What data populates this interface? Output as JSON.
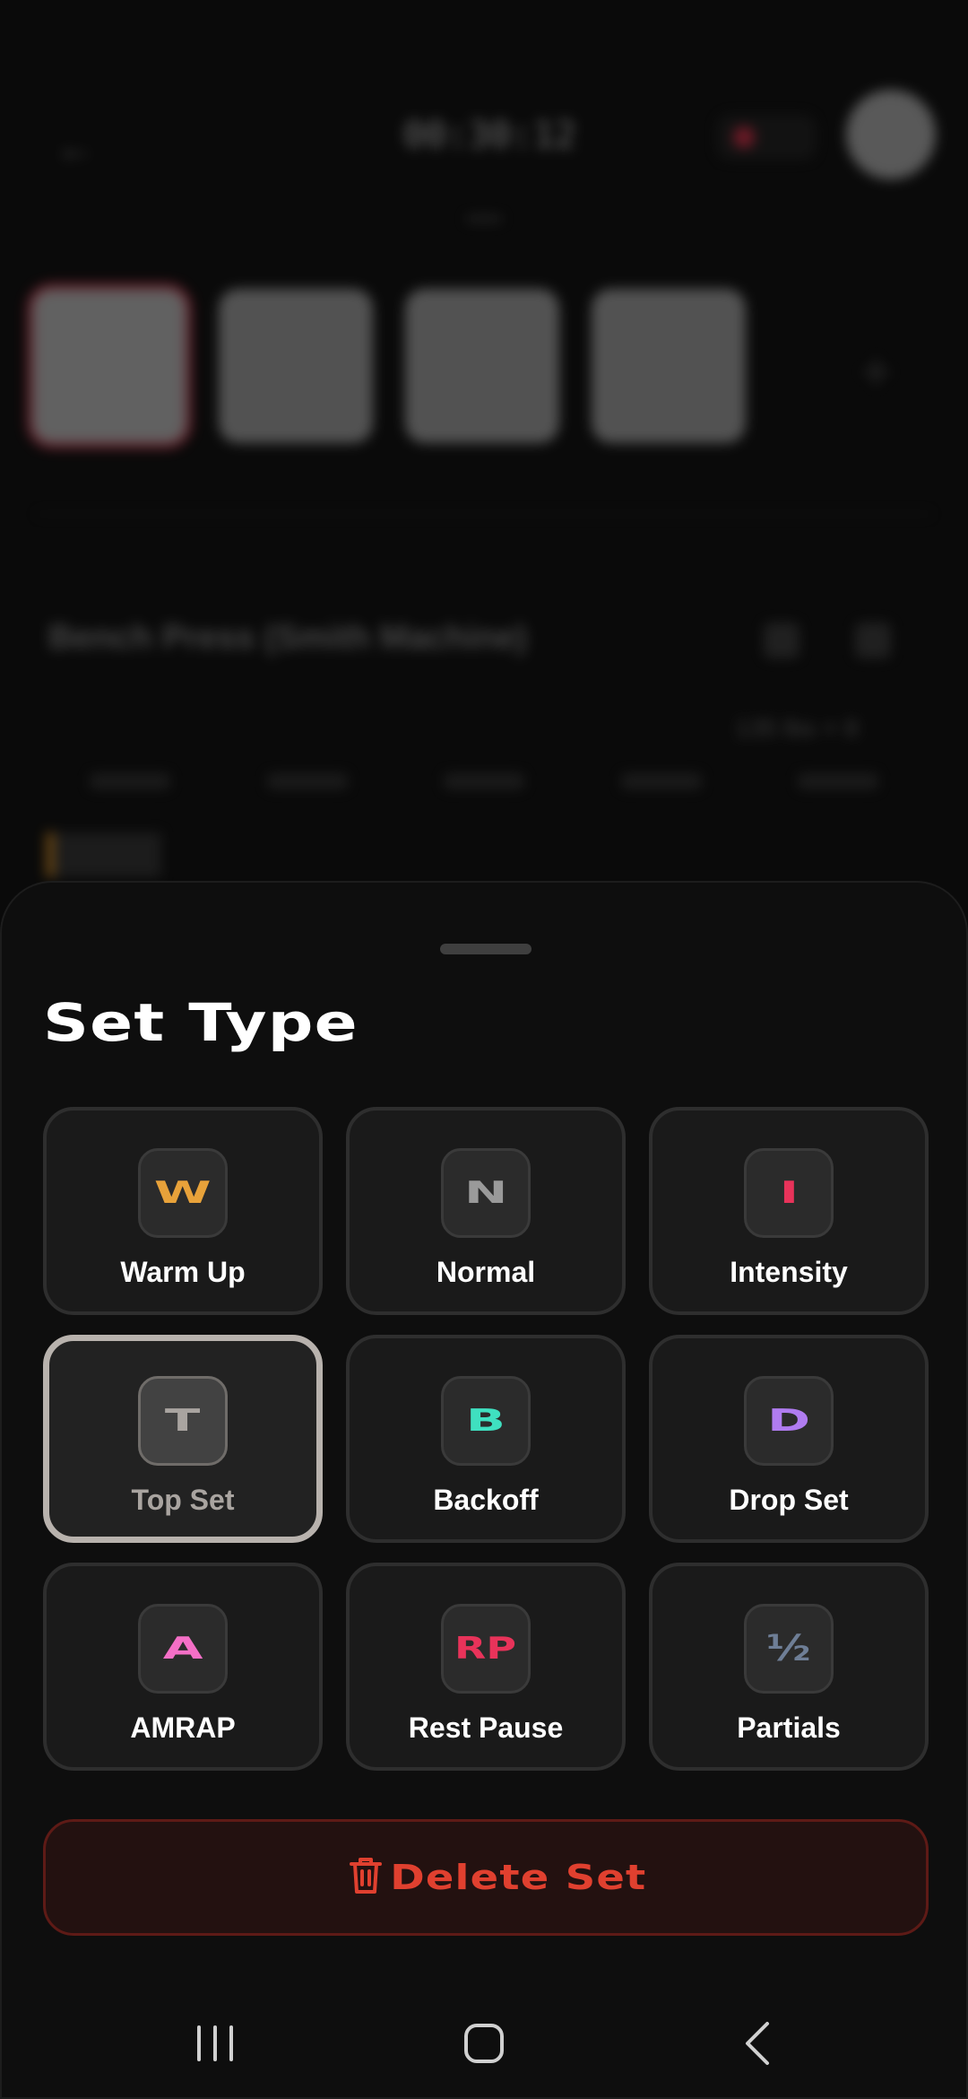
{
  "background": {
    "timer_text": "00:30:12",
    "exercise_title": "Bench Press (Smith Machine)",
    "subtitle": "135 lbs × 8"
  },
  "sheet": {
    "title": "Set Type",
    "set_types": [
      {
        "key": "W",
        "label": "Warm Up",
        "color": "#E8A23A",
        "selected": false
      },
      {
        "key": "N",
        "label": "Normal",
        "color": "#9A9A9A",
        "selected": false
      },
      {
        "key": "I",
        "label": "Intensity",
        "color": "#E8335A",
        "selected": false
      },
      {
        "key": "T",
        "label": "Top Set",
        "color": "#A9A4A0",
        "selected": true
      },
      {
        "key": "B",
        "label": "Backoff",
        "color": "#3FE0C0",
        "selected": false
      },
      {
        "key": "D",
        "label": "Drop Set",
        "color": "#B07CF0",
        "selected": false
      },
      {
        "key": "A",
        "label": "AMRAP",
        "color": "#F46FC6",
        "selected": false
      },
      {
        "key": "RP",
        "label": "Rest Pause",
        "color": "#E8335A",
        "selected": false
      },
      {
        "key": "½",
        "label": "Partials",
        "color": "#6E7E96",
        "selected": false
      }
    ],
    "delete_label": "Delete Set",
    "delete_color": "#E0402F"
  },
  "navbar": {
    "icons": [
      "recent-apps-icon",
      "home-icon",
      "back-icon"
    ]
  }
}
